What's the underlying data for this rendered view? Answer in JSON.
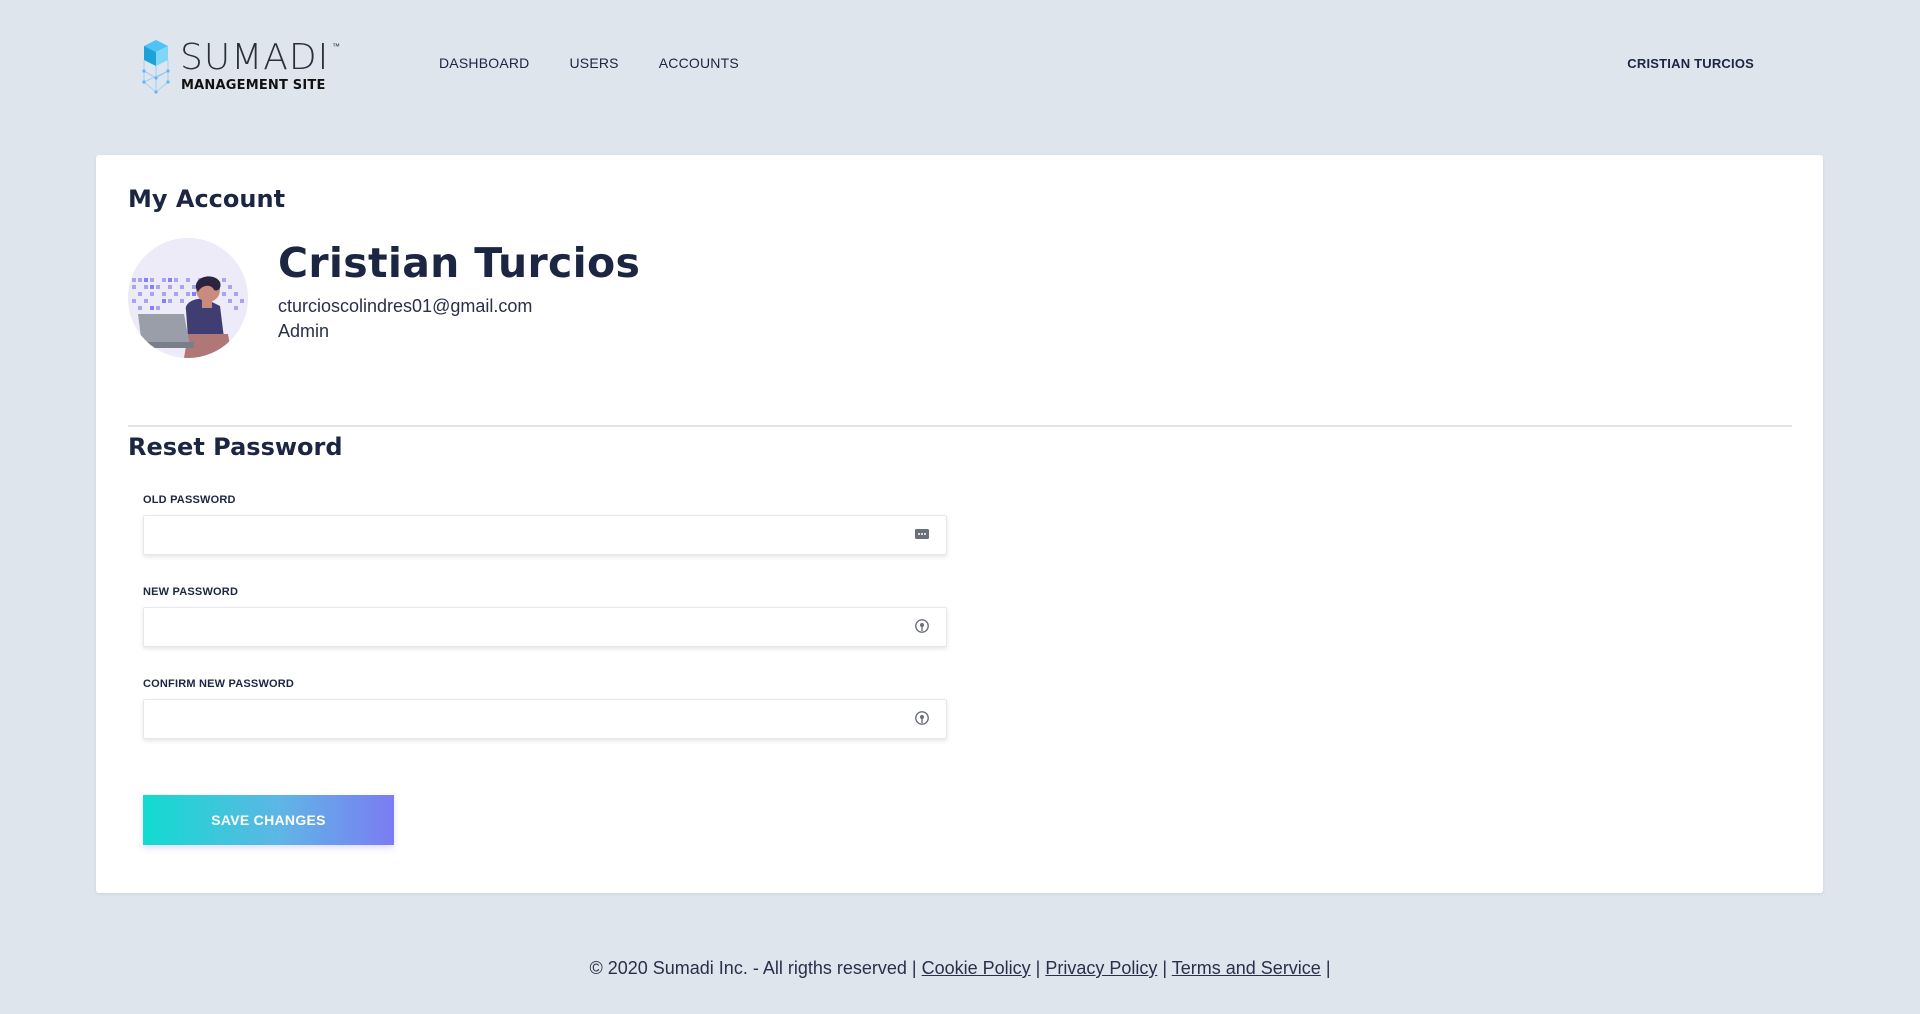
{
  "header": {
    "logo_word": "SUMADI",
    "logo_tm": "™",
    "logo_sub": "MANAGEMENT SITE",
    "nav": [
      {
        "label": "DASHBOARD"
      },
      {
        "label": "USERS"
      },
      {
        "label": "ACCOUNTS"
      }
    ],
    "user_name": "CRISTIAN TURCIOS"
  },
  "account": {
    "title": "My Account",
    "name": "Cristian Turcios",
    "email": "cturcioscolindres01@gmail.com",
    "role": "Admin"
  },
  "reset": {
    "title": "Reset Password",
    "fields": [
      {
        "label": "OLD PASSWORD",
        "value": "",
        "icon": "password-dots-icon"
      },
      {
        "label": "NEW PASSWORD",
        "value": "",
        "icon": "key-icon"
      },
      {
        "label": "CONFIRM NEW PASSWORD",
        "value": "",
        "icon": "key-icon"
      }
    ],
    "save_label": "SAVE CHANGES"
  },
  "footer": {
    "copyright": "© 2020 Sumadi Inc. - All rigths reserved |",
    "links": [
      "Cookie Policy",
      "Privacy Policy",
      "Terms and Service"
    ],
    "sep": "|"
  },
  "colors": {
    "background": "#dfe5ed",
    "text": "#1c2541",
    "button_start": "#11dccf",
    "button_end": "#7b7cf3"
  }
}
